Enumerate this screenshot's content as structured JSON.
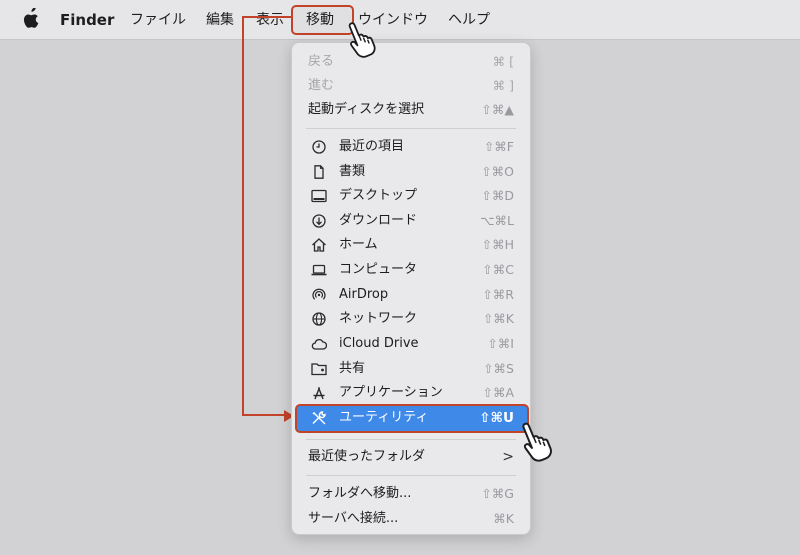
{
  "menubar": {
    "app_name": "Finder",
    "items": [
      "ファイル",
      "編集",
      "表示",
      "移動",
      "ウインドウ",
      "ヘルプ"
    ]
  },
  "go_menu": {
    "items": [
      {
        "label": "戻る",
        "shortcut": "⌘ [",
        "disabled": true
      },
      {
        "label": "進む",
        "shortcut": "⌘ ]",
        "disabled": true
      },
      {
        "label": "起動ディスクを選択",
        "shortcut": "⇧⌘▲"
      },
      {
        "label": "最近の項目",
        "shortcut": "⇧⌘F",
        "icon": "clock-icon"
      },
      {
        "label": "書類",
        "shortcut": "⇧⌘O",
        "icon": "document-icon"
      },
      {
        "label": "デスクトップ",
        "shortcut": "⇧⌘D",
        "icon": "desktop-icon"
      },
      {
        "label": "ダウンロード",
        "shortcut": "⌥⌘L",
        "icon": "download-icon"
      },
      {
        "label": "ホーム",
        "shortcut": "⇧⌘H",
        "icon": "home-icon"
      },
      {
        "label": "コンピュータ",
        "shortcut": "⇧⌘C",
        "icon": "laptop-icon"
      },
      {
        "label": "AirDrop",
        "shortcut": "⇧⌘R",
        "icon": "airdrop-icon"
      },
      {
        "label": "ネットワーク",
        "shortcut": "⇧⌘K",
        "icon": "globe-icon"
      },
      {
        "label": "iCloud Drive",
        "shortcut": "⇧⌘I",
        "icon": "cloud-icon"
      },
      {
        "label": "共有",
        "shortcut": "⇧⌘S",
        "icon": "shared-folder-icon"
      },
      {
        "label": "アプリケーション",
        "shortcut": "⇧⌘A",
        "icon": "applications-icon"
      },
      {
        "label": "ユーティリティ",
        "shortcut": "⇧⌘U",
        "icon": "utilities-icon",
        "selected": true
      },
      {
        "label": "最近使ったフォルダ",
        "shortcut": ">",
        "submenu": true
      },
      {
        "label": "フォルダへ移動...",
        "shortcut": "⇧⌘G"
      },
      {
        "label": "サーバへ接続...",
        "shortcut": "⌘K"
      }
    ]
  },
  "colors": {
    "highlight_border": "#c0432a",
    "selection_blue": "#3f8ae8",
    "menubar_bg": "#e6e6e8",
    "desktop_bg": "#d2d2d4"
  }
}
